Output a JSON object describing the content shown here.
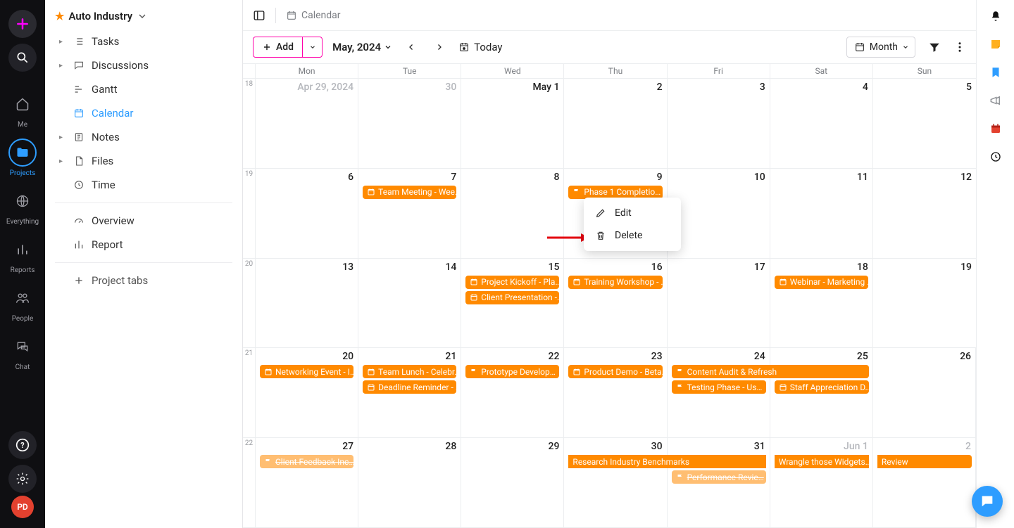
{
  "rail": {
    "me": "Me",
    "projects": "Projects",
    "everything": "Everything",
    "reports": "Reports",
    "people": "People",
    "chat": "Chat",
    "avatar": "PD"
  },
  "sidebar": {
    "project_title": "Auto Industry",
    "items": [
      {
        "label": "Tasks",
        "expandable": true
      },
      {
        "label": "Discussions",
        "expandable": true
      },
      {
        "label": "Gantt",
        "expandable": false
      },
      {
        "label": "Calendar",
        "expandable": false,
        "active": true
      },
      {
        "label": "Notes",
        "expandable": true
      },
      {
        "label": "Files",
        "expandable": true
      },
      {
        "label": "Time",
        "expandable": false
      }
    ],
    "section2": [
      {
        "label": "Overview"
      },
      {
        "label": "Report"
      }
    ],
    "project_tabs": "Project tabs"
  },
  "breadcrumb": {
    "view": "Calendar"
  },
  "toolbar": {
    "add": "Add",
    "month_label": "May, 2024",
    "today": "Today",
    "view": "Month"
  },
  "dow": [
    "Mon",
    "Tue",
    "Wed",
    "Thu",
    "Fri",
    "Sat",
    "Sun"
  ],
  "weeks": [
    {
      "num": "18",
      "days": [
        {
          "label": "Apr 29, 2024",
          "outside": true
        },
        {
          "label": "30",
          "outside": true
        },
        {
          "label": "May 1"
        },
        {
          "label": "2"
        },
        {
          "label": "3"
        },
        {
          "label": "4"
        },
        {
          "label": "5"
        }
      ],
      "spans": []
    },
    {
      "num": "19",
      "days": [
        {
          "label": "6"
        },
        {
          "label": "7"
        },
        {
          "label": "8"
        },
        {
          "label": "9"
        },
        {
          "label": "10"
        },
        {
          "label": "11"
        },
        {
          "label": "12"
        }
      ],
      "in_cell": {
        "1": [
          {
            "text": "Team Meeting - Wee…",
            "icon": "cal"
          }
        ],
        "3": [
          {
            "text": "Phase 1 Completio…",
            "icon": "flag"
          }
        ]
      }
    },
    {
      "num": "20",
      "days": [
        {
          "label": "13"
        },
        {
          "label": "14"
        },
        {
          "label": "15"
        },
        {
          "label": "16"
        },
        {
          "label": "17"
        },
        {
          "label": "18"
        },
        {
          "label": "19"
        }
      ],
      "in_cell": {
        "2": [
          {
            "text": "Project Kickoff - Pla…",
            "icon": "cal"
          },
          {
            "text": "Client Presentation -…",
            "icon": "cal"
          }
        ],
        "3": [
          {
            "text": "Training Workshop - …",
            "icon": "cal"
          }
        ],
        "5": [
          {
            "text": "Webinar - Marketing …",
            "icon": "cal"
          }
        ]
      }
    },
    {
      "num": "21",
      "days": [
        {
          "label": "20"
        },
        {
          "label": "21"
        },
        {
          "label": "22"
        },
        {
          "label": "23"
        },
        {
          "label": "24"
        },
        {
          "label": "25"
        },
        {
          "label": "26"
        }
      ],
      "in_cell": {
        "0": [
          {
            "text": "Networking Event - I…",
            "icon": "cal"
          }
        ],
        "1": [
          {
            "text": "Team Lunch - Celebr…",
            "icon": "cal"
          },
          {
            "text": "Deadline Reminder - …",
            "icon": "cal"
          }
        ],
        "2": [
          {
            "text": "Prototype Develop…",
            "icon": "flag"
          }
        ],
        "3": [
          {
            "text": "Product Demo - Beta…",
            "icon": "cal"
          }
        ]
      },
      "spans": [
        {
          "row": 0,
          "from": 4,
          "to": 5,
          "text": "Content Audit & Refresh",
          "icon": "flag"
        },
        {
          "row": 1,
          "from": 4,
          "to": 4,
          "text": "Testing Phase - Us…",
          "icon": "flag"
        },
        {
          "row": 1,
          "from": 5,
          "to": 5,
          "text": "Staff Appreciation D…",
          "icon": "cal"
        }
      ]
    },
    {
      "num": "22",
      "days": [
        {
          "label": "27"
        },
        {
          "label": "28"
        },
        {
          "label": "29"
        },
        {
          "label": "30"
        },
        {
          "label": "31"
        },
        {
          "label": "Jun 1",
          "outside": true
        },
        {
          "label": "2",
          "outside": true
        }
      ],
      "in_cell": {
        "0": [
          {
            "text": "Client Feedback Inc…",
            "icon": "flag",
            "faded": true,
            "strike": true
          }
        ]
      },
      "spans": [
        {
          "row": 0,
          "from": 3,
          "to": 4,
          "text": "Research Industry Benchmarks",
          "icon": "",
          "square": "both"
        },
        {
          "row": 0,
          "from": 5,
          "to": 5,
          "text": "Wrangle those Widgets…",
          "icon": "",
          "square": "both"
        },
        {
          "row": 0,
          "from": 6,
          "to": 6,
          "text": "Review",
          "icon": "",
          "square": "left"
        },
        {
          "row": 1,
          "from": 4,
          "to": 4,
          "text": "Performance Revie…",
          "icon": "flag",
          "faded": true,
          "strike": true
        }
      ]
    }
  ],
  "context_menu": {
    "edit": "Edit",
    "delete": "Delete"
  },
  "colors": {
    "accent_orange": "#ff8a00",
    "brand_blue": "#2e9dff",
    "brand_pink": "#ff00aa"
  }
}
